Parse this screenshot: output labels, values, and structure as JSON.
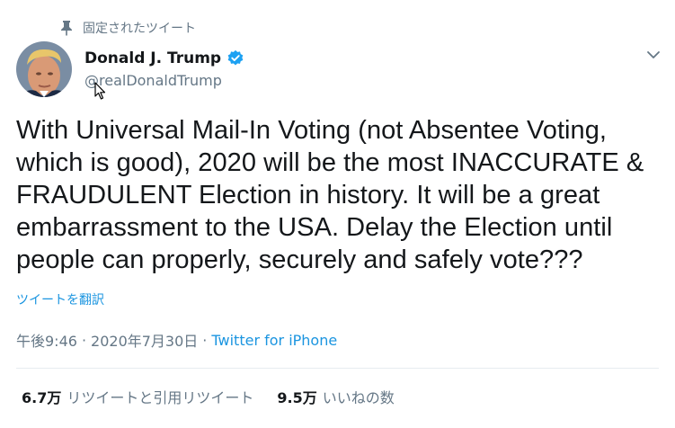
{
  "pinned_label": "固定されたツイート",
  "author": {
    "display_name": "Donald J. Trump",
    "handle": "@realDonaldTrump"
  },
  "tweet": {
    "text": "With Universal Mail-In Voting (not Absentee Voting, which is good), 2020 will be the most INACCURATE & FRAUDULENT Election in history. It will be a great embarrassment to the USA. Delay the Election until people can properly, securely and safely vote???",
    "translate_label": "ツイートを翻訳",
    "time": "午後9:46",
    "date": "2020年7月30日",
    "separator": "·",
    "source": "Twitter for iPhone"
  },
  "stats": {
    "retweets_count": "6.7万",
    "retweets_label": "リツイートと引用リツイート",
    "likes_count": "9.5万",
    "likes_label": "いいねの数"
  },
  "colors": {
    "accent": "#1b95e0",
    "secondary_text": "#657786",
    "verified": "#1da1f2"
  },
  "icons": [
    "pin-icon",
    "verified-badge-icon",
    "chevron-down-icon",
    "mouse-cursor-icon"
  ]
}
